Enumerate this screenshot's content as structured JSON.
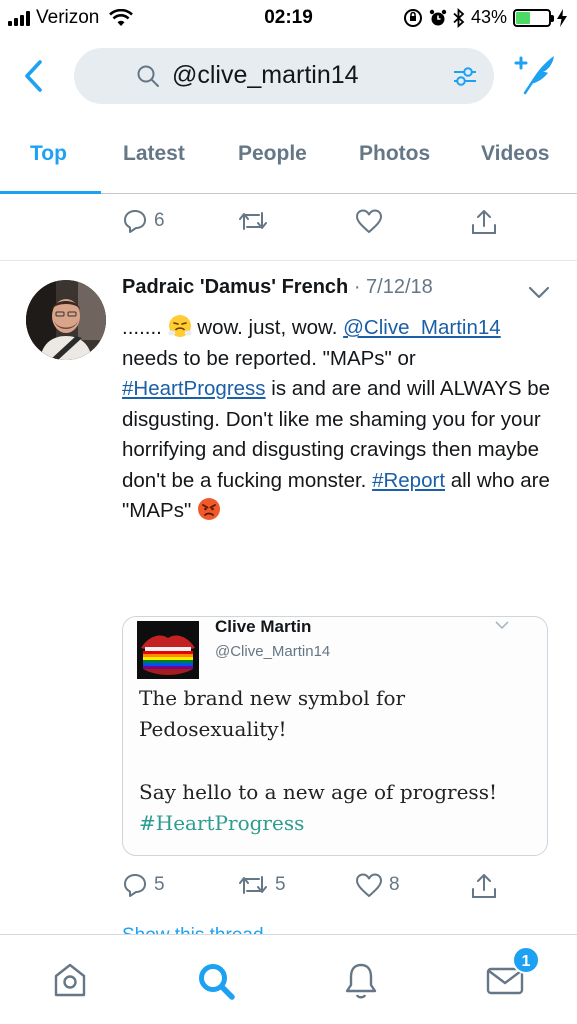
{
  "status_bar": {
    "carrier": "Verizon",
    "time": "02:19",
    "battery": "43%",
    "battery_level": 0.43,
    "icons": [
      "signal-icon",
      "wifi-icon",
      "orientation-lock-icon",
      "alarm-icon",
      "bluetooth-icon",
      "battery-icon",
      "charging-icon"
    ]
  },
  "search": {
    "query": "@clive_martin14",
    "icons": [
      "back-icon",
      "search-icon",
      "filter-icon",
      "compose-icon"
    ]
  },
  "tabs": [
    {
      "label": "Top",
      "active": true
    },
    {
      "label": "Latest",
      "active": false
    },
    {
      "label": "People",
      "active": false
    },
    {
      "label": "Photos",
      "active": false
    },
    {
      "label": "Videos",
      "active": false
    }
  ],
  "previous_tweet_actions": {
    "replies": "6",
    "retweets": "",
    "likes": ""
  },
  "tweet": {
    "author_name": "Padraic 'Damus' French",
    "meta": " · 7/12/18",
    "line1_prefix": "....... ",
    "line1_suffix": " wow. just, wow.",
    "mention": "@Clive_Martin14",
    "after_mention": " needs to be reported. \"MAPs\" or ",
    "hashtag1": "#HeartProgress",
    "middle_text": " is and are and will ALWAYS be disgusting. Don't like me shaming you for your horrifying and disgusting cravings then maybe don't be a fucking monster. ",
    "hashtag2": "#Report",
    "end_text": " all who are \"MAPs\" ",
    "quoted_image": {
      "name": "Clive Martin",
      "handle": "@Clive_Martin14",
      "text_line1": "The brand new symbol for",
      "text_line2": "Pedosexuality!",
      "text_line3": "Say hello to a new age of progress!",
      "hashtag": "#HeartProgress"
    },
    "actions": {
      "replies": "5",
      "retweets": "5",
      "likes": "8"
    },
    "show_thread": "Show this thread"
  },
  "bottom_nav": {
    "items": [
      "home-icon",
      "search-icon",
      "notifications-icon",
      "messages-icon"
    ],
    "messages_badge": "1"
  },
  "colors": {
    "accent": "#1da1f2",
    "link": "#1b5fa8",
    "muted": "#657786",
    "battery": "#4cd964"
  }
}
